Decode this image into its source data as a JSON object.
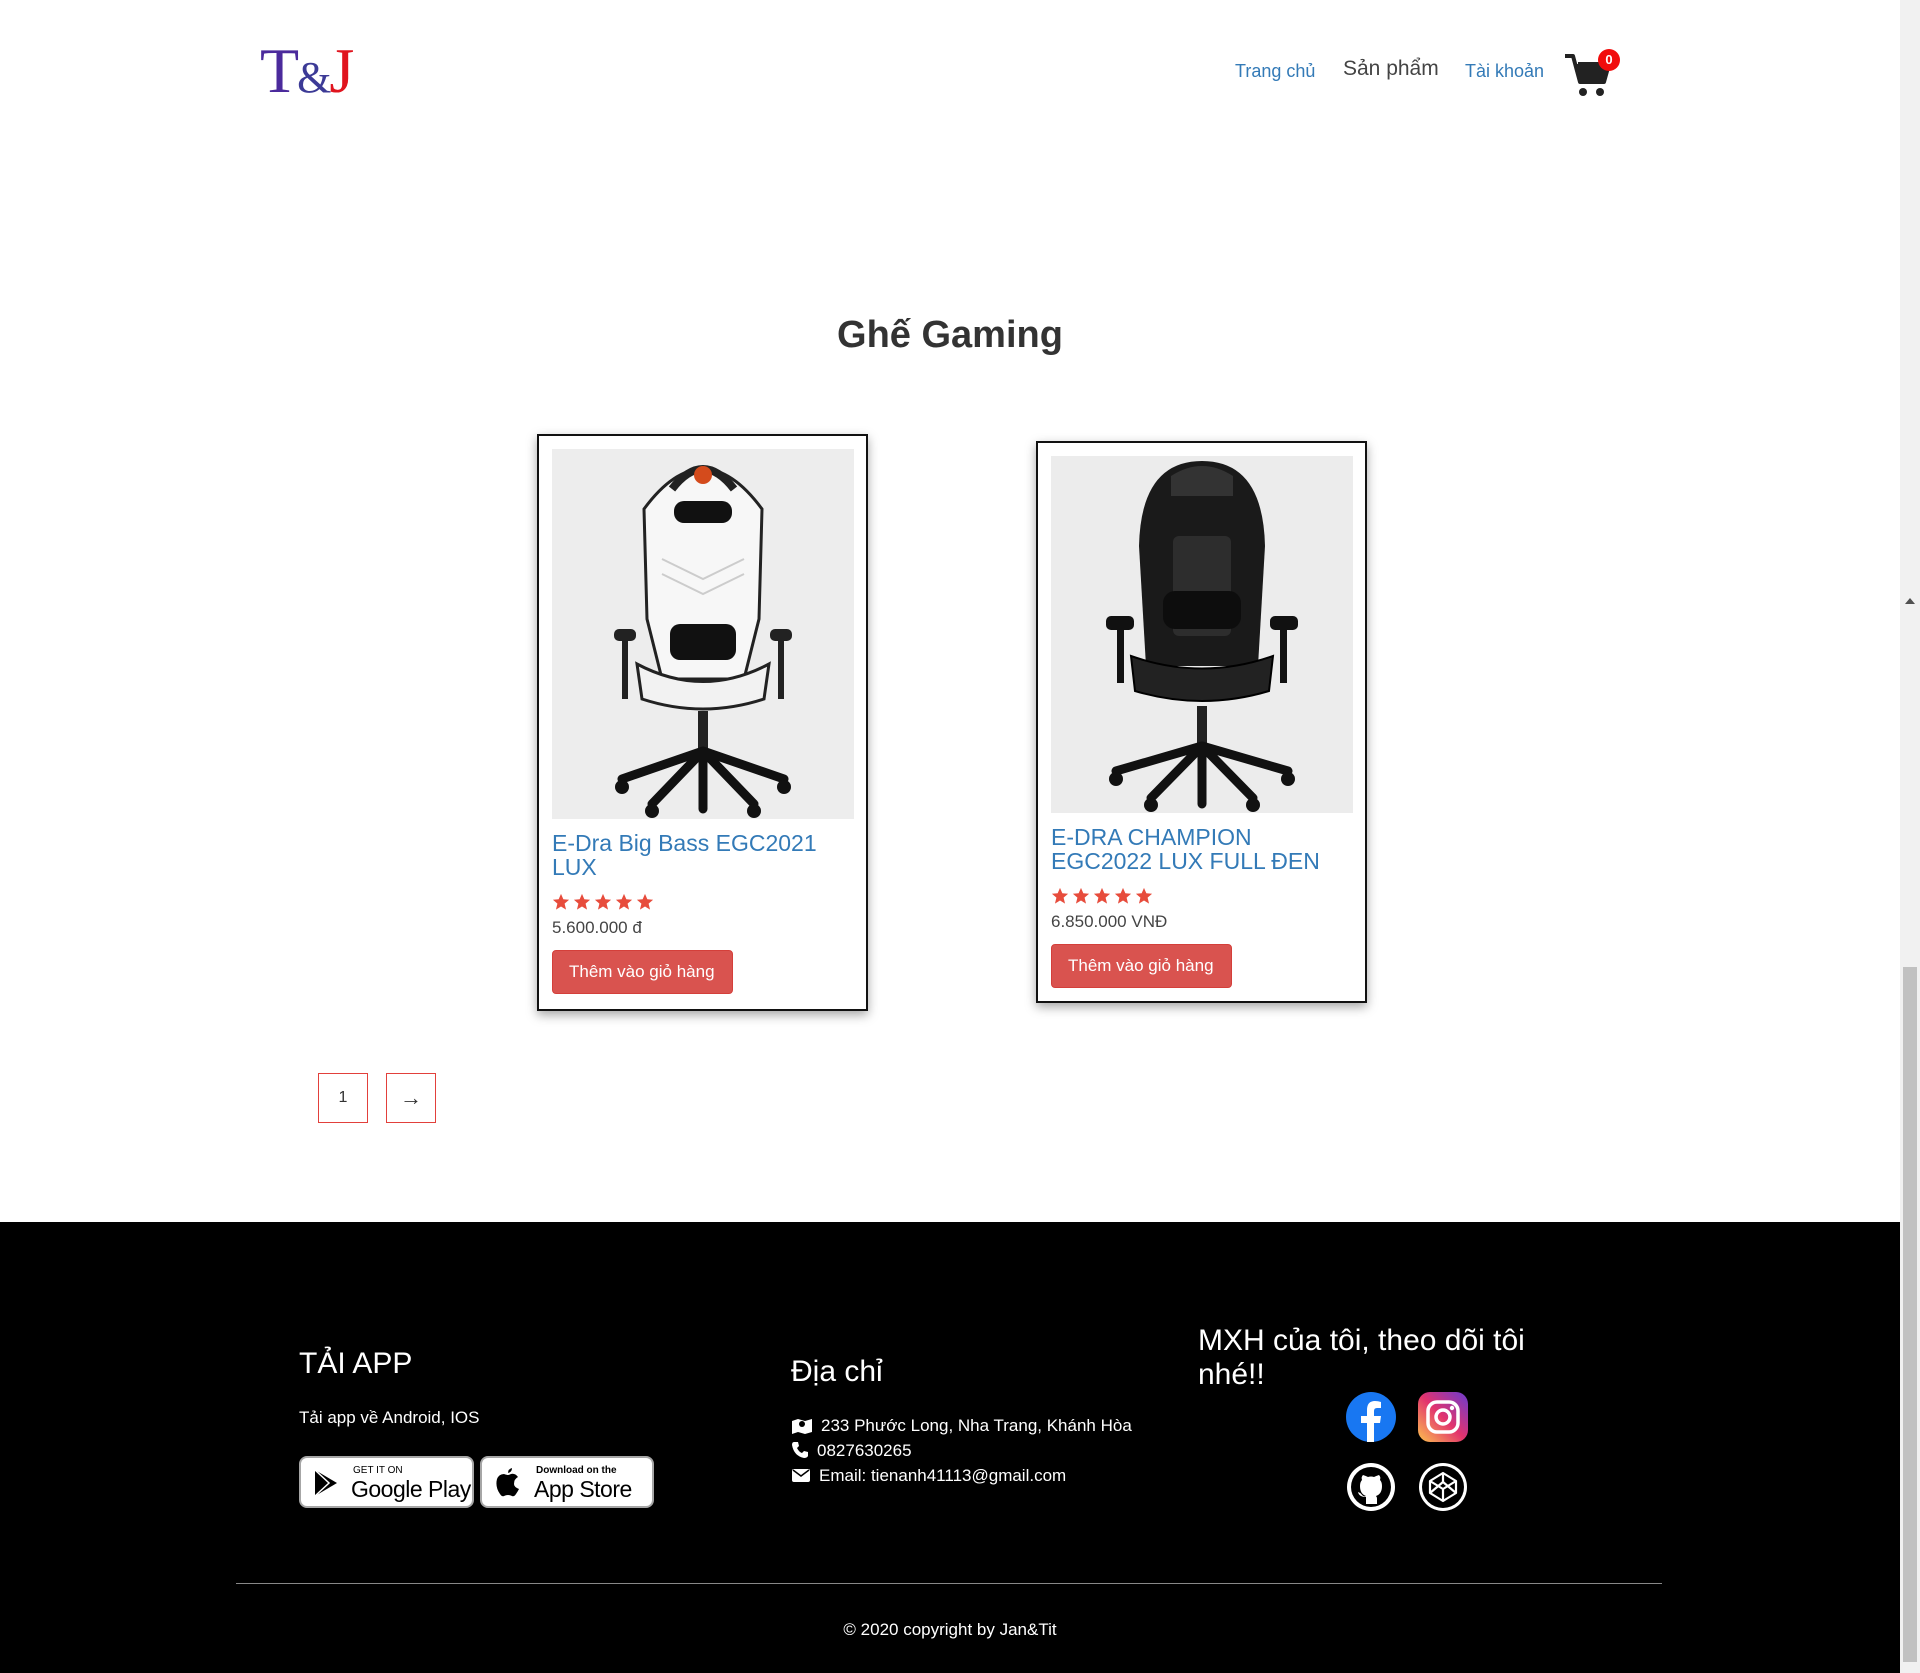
{
  "header": {
    "logo": {
      "t": "T",
      "amp": "&",
      "j": "J"
    },
    "nav": {
      "home": "Trang chủ",
      "products": "Sản phẩm",
      "account": "Tài khoản"
    },
    "cart_count": "0"
  },
  "section_title": "Ghế Gaming",
  "products": [
    {
      "name": "E-Dra Big Bass EGC2021 LUX",
      "rating": 5,
      "price": "5.600.000 đ",
      "button": "Thêm vào giỏ hàng",
      "image": "white-gaming-chair"
    },
    {
      "name": "E-DRA CHAMPION EGC2022 LUX FULL ĐEN",
      "rating": 5,
      "price": "6.850.000 VNĐ",
      "button": "Thêm vào giỏ hàng",
      "image": "black-gaming-chair"
    }
  ],
  "pagination": {
    "current": "1",
    "next": "→"
  },
  "footer": {
    "app_title": "TẢI APP",
    "app_text": "Tải app về Android, IOS",
    "google_play": {
      "small": "GET IT ON",
      "big": "Google Play"
    },
    "app_store": {
      "small": "Download on the",
      "big": "App Store"
    },
    "address_title": "Địa chỉ",
    "address": "233 Phước Long, Nha Trang, Khánh Hòa",
    "phone": "0827630265",
    "email": "Email: tienanh41113@gmail.com",
    "social_title": "MXH của tôi, theo dõi tôi nhé!!",
    "social_icons": [
      "facebook-icon",
      "instagram-icon",
      "github-icon",
      "codepen-icon"
    ],
    "copyright": "© 2020 copyright by Jan&Tit"
  },
  "colors": {
    "link": "#337ab7",
    "button": "#d9534f",
    "stars": "#e74c3c",
    "badge": "#f10c0c",
    "footer_bg": "#000000"
  }
}
